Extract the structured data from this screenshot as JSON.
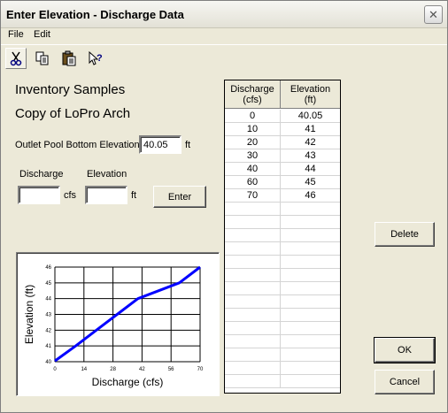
{
  "window": {
    "title": "Enter Elevation - Discharge Data",
    "close_glyph": "✕"
  },
  "menu": {
    "items": [
      "File",
      "Edit"
    ]
  },
  "toolbar": {
    "icons": [
      "scissors-icon",
      "copy-icon",
      "paste-icon",
      "help-icon"
    ]
  },
  "header": {
    "line1": "Inventory Samples",
    "line2": "Copy of LoPro Arch"
  },
  "outlet": {
    "label": "Outlet Pool Bottom Elevation:",
    "value": "40.05",
    "unit": "ft"
  },
  "entry": {
    "discharge_label": "Discharge",
    "elevation_label": "Elevation",
    "discharge_value": "",
    "elevation_value": "",
    "discharge_unit": "cfs",
    "elevation_unit": "ft",
    "enter_label": "Enter"
  },
  "table": {
    "col1_header_line1": "Discharge",
    "col1_header_line2": "(cfs)",
    "col2_header_line1": "Elevation",
    "col2_header_line2": "(ft)",
    "rows": [
      [
        "0",
        "40.05"
      ],
      [
        "10",
        "41"
      ],
      [
        "20",
        "42"
      ],
      [
        "30",
        "43"
      ],
      [
        "40",
        "44"
      ],
      [
        "60",
        "45"
      ],
      [
        "70",
        "46"
      ]
    ]
  },
  "buttons": {
    "delete_label": "Delete",
    "ok_label": "OK",
    "cancel_label": "Cancel"
  },
  "chart_data": {
    "type": "line",
    "title": "",
    "xlabel": "Discharge (cfs)",
    "ylabel": "Elevation (ft)",
    "x": [
      0,
      10,
      20,
      30,
      40,
      60,
      70
    ],
    "y": [
      40.05,
      41,
      42,
      43,
      44,
      45,
      46
    ],
    "xlim": [
      0,
      70
    ],
    "ylim": [
      40,
      46
    ],
    "xticks": [
      "0",
      "14",
      "28",
      "42",
      "56",
      "70"
    ],
    "yticks": [
      "40",
      "41",
      "42",
      "43",
      "44",
      "45",
      "46"
    ],
    "grid": true,
    "line_color": "#0000FF"
  }
}
